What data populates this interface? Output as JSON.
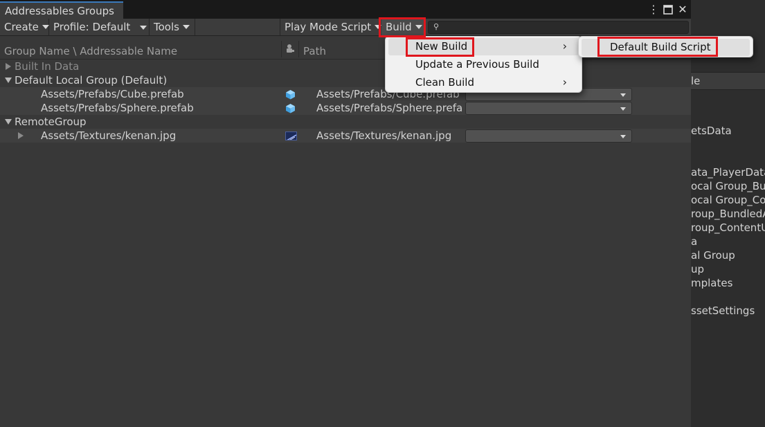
{
  "window": {
    "title": "Addressables Groups",
    "controls": {
      "more": "⋮",
      "maximize": "□",
      "close": "✕"
    }
  },
  "toolbar": {
    "create_label": "Create",
    "profile_label": "Profile: Default",
    "tools_label": "Tools",
    "play_mode_label": "Play Mode Script",
    "build_label": "Build",
    "search_value": ""
  },
  "columns": {
    "name_header": "Group Name \\ Addressable Name",
    "path_header": "Path"
  },
  "groups": [
    {
      "name": "Built In Data",
      "expanded": false,
      "muted": true
    },
    {
      "name": "Default Local Group (Default)",
      "expanded": true
    },
    {
      "name": "RemoteGroup",
      "expanded": true
    }
  ],
  "entries": [
    {
      "name": "Assets/Prefabs/Cube.prefab",
      "path": "Assets/Prefabs/Cube.prefab",
      "icon": "cube-prefab-icon"
    },
    {
      "name": "Assets/Prefabs/Sphere.prefab",
      "path": "Assets/Prefabs/Sphere.prefab",
      "icon": "cube-prefab-icon"
    },
    {
      "name": "Assets/Textures/kenan.jpg",
      "path": "Assets/Textures/kenan.jpg",
      "icon": "texture-thumbnail-icon"
    }
  ],
  "build_menu": {
    "items": [
      {
        "label": "New Build",
        "has_submenu": true
      },
      {
        "label": "Update a Previous Build",
        "has_submenu": false
      },
      {
        "label": "Clean Build",
        "has_submenu": true
      }
    ],
    "submenu_items": [
      {
        "label": "Default Build Script"
      }
    ]
  },
  "background_panel": {
    "header_fragment": "le",
    "lines": [
      "etsData",
      "ata_PlayerData",
      "ocal Group_Bun",
      "ocal Group_Con",
      "roup_BundledA",
      "roup_ContentU",
      "a",
      "al Group",
      "up",
      "mplates",
      "ssetSettings"
    ]
  },
  "colors": {
    "highlight_box": "#e0161d",
    "tab_accent": "#3a79bb",
    "menu_bg": "#f1f1f1",
    "window_bg": "#383838"
  }
}
